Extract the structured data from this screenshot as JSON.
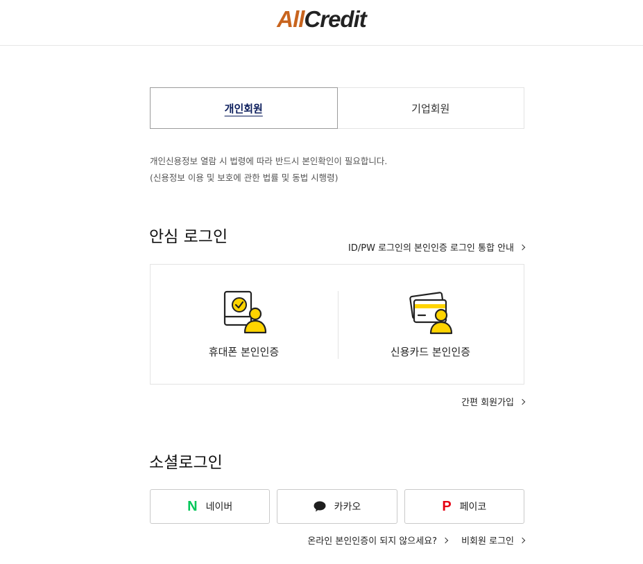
{
  "header": {
    "logo_part1": "All",
    "logo_part2": "Credit",
    "logo_colors": {
      "all": "#c8641e",
      "credit": "#222222"
    }
  },
  "tabs": [
    {
      "label": "개인회원",
      "active": true
    },
    {
      "label": "기업회원",
      "active": false
    }
  ],
  "notice": {
    "line1": "개인신용정보 열람 시 법령에 따라 반드시 본인확인이 필요합니다.",
    "line2": "(신용정보 이용 및 보호에 관한 법률 및 동법 시행령)"
  },
  "safe_login": {
    "title": "안심 로그인",
    "guide_link": "ID/PW 로그인의 본인인증 로그인 통합 안내",
    "options": [
      {
        "label": "휴대폰 본인인증",
        "icon": "phone-verify-icon"
      },
      {
        "label": "신용카드 본인인증",
        "icon": "credit-card-verify-icon"
      }
    ],
    "signup_link": "간편 회원가입"
  },
  "social_login": {
    "title": "소셜로그인",
    "buttons": [
      {
        "label": "네이버",
        "icon": "naver-icon",
        "glyph": "N",
        "color": "#03c75a"
      },
      {
        "label": "카카오",
        "icon": "kakao-icon",
        "color": "#1e1e1e"
      },
      {
        "label": "페이코",
        "icon": "payco-icon",
        "glyph": "P",
        "color": "#e60012"
      }
    ]
  },
  "bottom_links": {
    "online_help": "온라인 본인인증이 되지 않으세요?",
    "guest_login": "비회원 로그인"
  },
  "accent_color": "#ffd400"
}
